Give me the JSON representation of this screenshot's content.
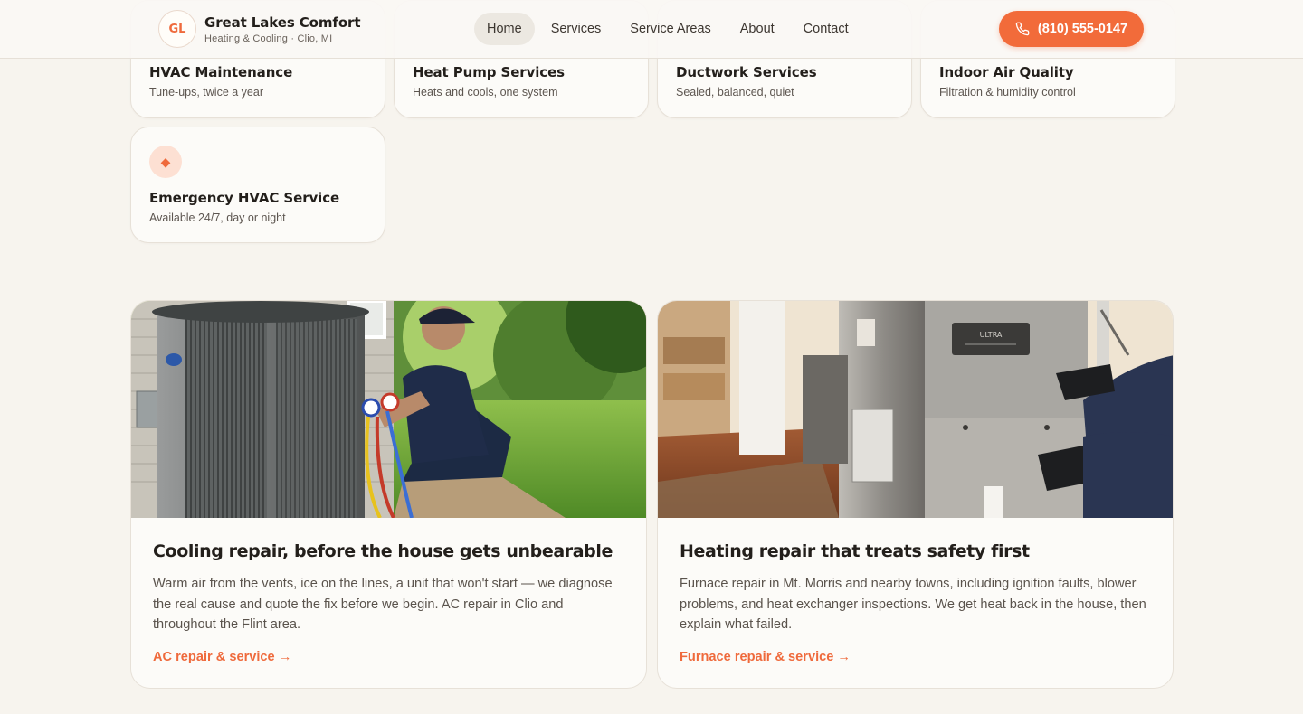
{
  "header": {
    "logo_initials": "GL",
    "brand_name": "Great Lakes Comfort",
    "brand_tagline": "Heating & Cooling · Clio, MI",
    "nav": [
      "Home",
      "Services",
      "Service Areas",
      "About",
      "Contact"
    ],
    "active_nav": "Home",
    "phone": "(810) 555-0147"
  },
  "services": [
    {
      "title": "HVAC Maintenance",
      "subtitle": "Tune-ups, twice a year"
    },
    {
      "title": "Heat Pump Services",
      "subtitle": "Heats and cools, one system"
    },
    {
      "title": "Ductwork Services",
      "subtitle": "Sealed, balanced, quiet"
    },
    {
      "title": "Indoor Air Quality",
      "subtitle": "Filtration & humidity control"
    },
    {
      "title": "Emergency HVAC Service",
      "subtitle": "Available 24/7, day or night",
      "icon": "diamond-icon"
    }
  ],
  "features": [
    {
      "title": "Cooling repair, before the house gets unbearable",
      "text": "Warm air from the vents, ice on the lines, a unit that won't start — we diagnose the real cause and quote the fix before we begin. AC repair in Clio and throughout the Flint area.",
      "link": "AC repair & service →",
      "image": "technician-servicing-outdoor-ac-unit"
    },
    {
      "title": "Heating repair that treats safety first",
      "text": "Furnace repair in Mt. Morris and nearby towns, including ignition faults, blower problems, and heat exchanger inspections. We get heat back in the house, then explain what failed.",
      "link": "Furnace repair & service →",
      "image": "technician-servicing-indoor-furnace",
      "furnace_label": "ULTRA"
    }
  ],
  "colors": {
    "accent": "#f26b3a",
    "background": "#f7f4ee",
    "card": "#fcfbf8"
  }
}
